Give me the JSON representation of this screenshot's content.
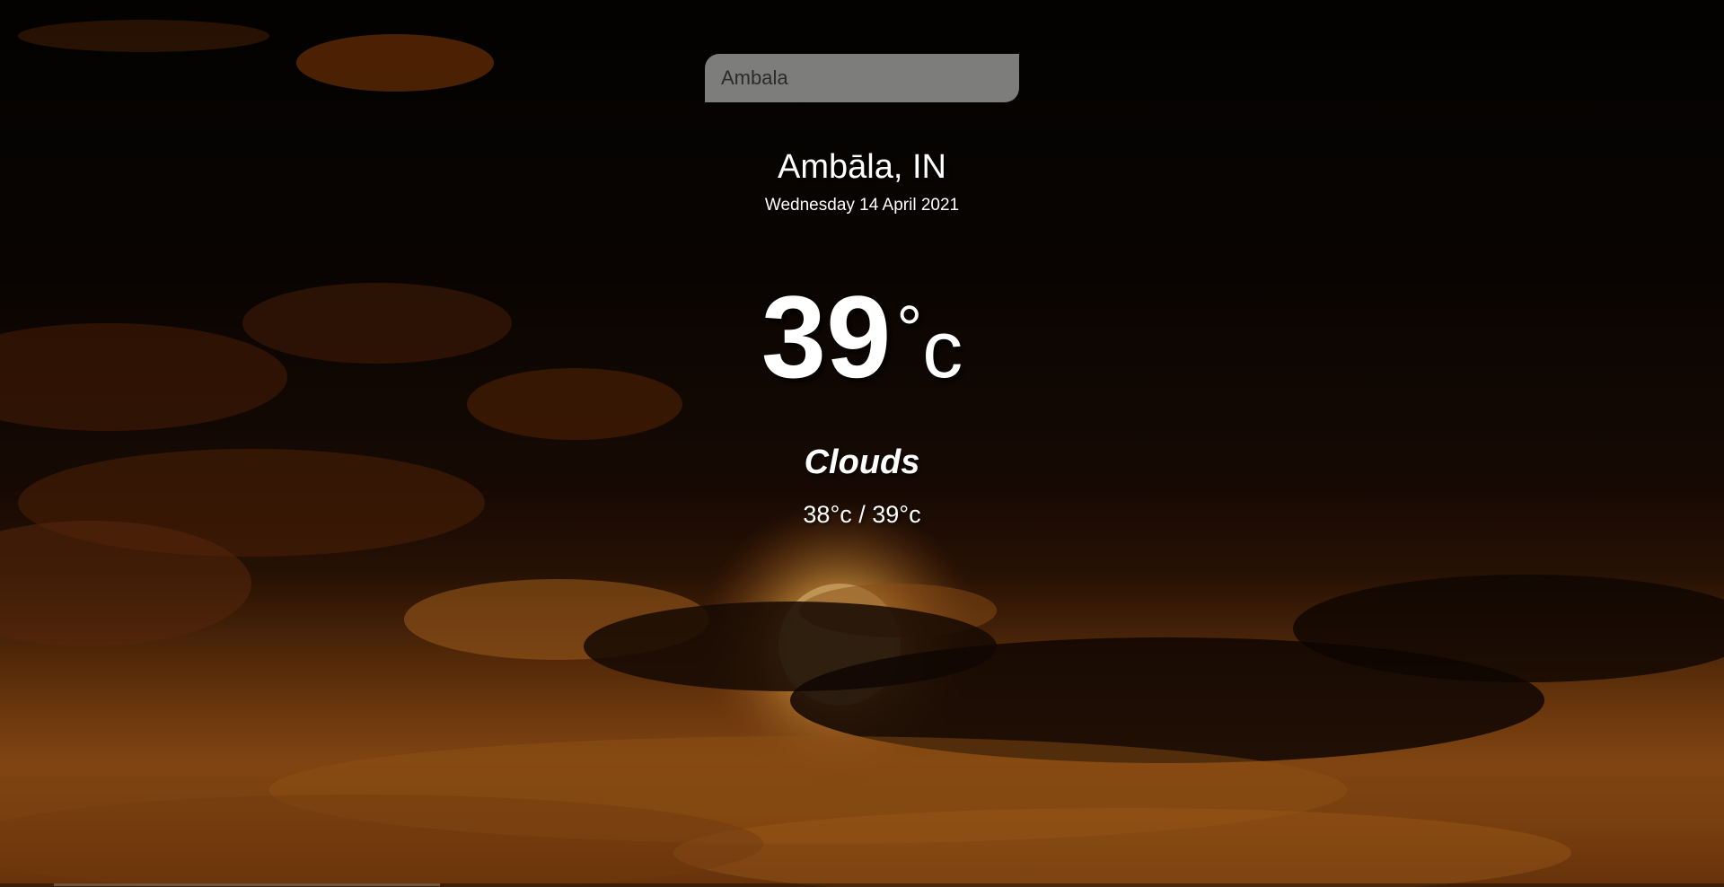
{
  "search": {
    "value": "Ambala",
    "placeholder": ""
  },
  "location": "Ambāla, IN",
  "date": "Wednesday 14 April 2021",
  "temperature": {
    "value": "39",
    "degree_symbol": "°",
    "unit": "c"
  },
  "condition": "Clouds",
  "range": "38°c / 39°c",
  "colors": {
    "text": "#ffffff",
    "search_bg": "#c8c8c8",
    "sky_top": "#050302",
    "sky_bottom": "#7a3c0c"
  }
}
